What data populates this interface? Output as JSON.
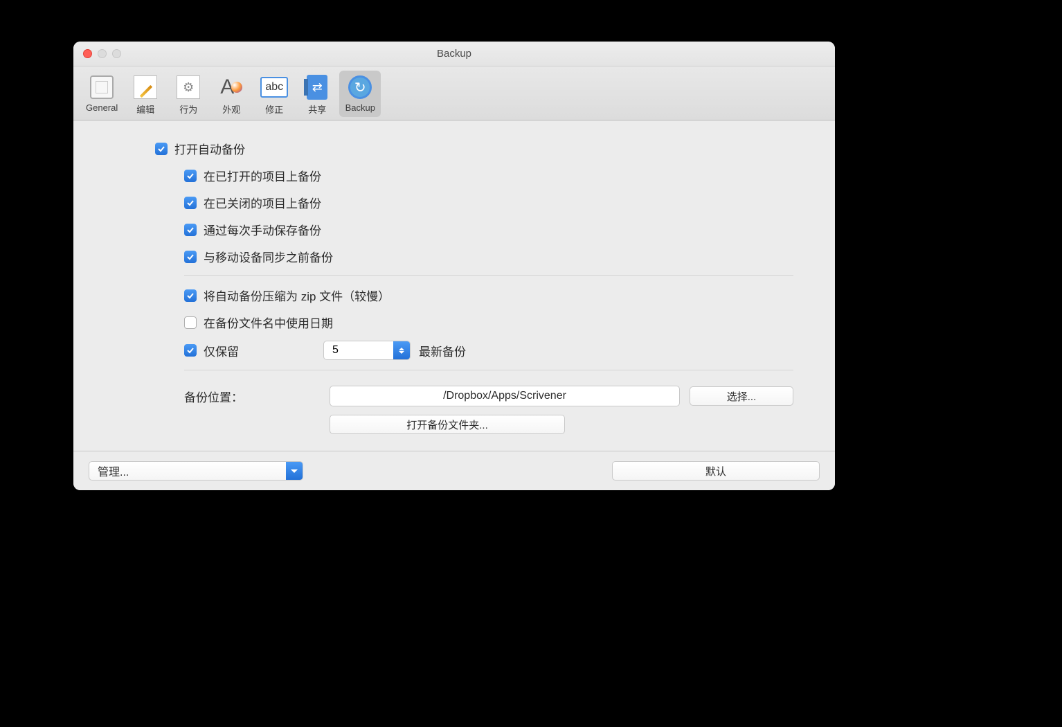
{
  "window": {
    "title": "Backup"
  },
  "toolbar": {
    "items": [
      {
        "label": "General"
      },
      {
        "label": "编辑"
      },
      {
        "label": "行为"
      },
      {
        "label": "外观"
      },
      {
        "label": "修正"
      },
      {
        "label": "共享"
      },
      {
        "label": "Backup"
      }
    ]
  },
  "options": {
    "auto_backup": "打开自动备份",
    "on_open": "在已打开的项目上备份",
    "on_close": "在已关闭的项目上备份",
    "on_manual_save": "通过每次手动保存备份",
    "before_sync": "与移动设备同步之前备份",
    "compress_zip": "将自动备份压缩为 zip 文件（较慢）",
    "use_date": "在备份文件名中使用日期",
    "retain_only": "仅保留",
    "retain_count": "5",
    "recent_backups": "最新备份"
  },
  "location": {
    "label": "备份位置：",
    "path": "/Dropbox/Apps/Scrivener",
    "choose": "选择...",
    "open_folder": "打开备份文件夹..."
  },
  "footer": {
    "manage": "管理...",
    "defaults": "默认"
  }
}
